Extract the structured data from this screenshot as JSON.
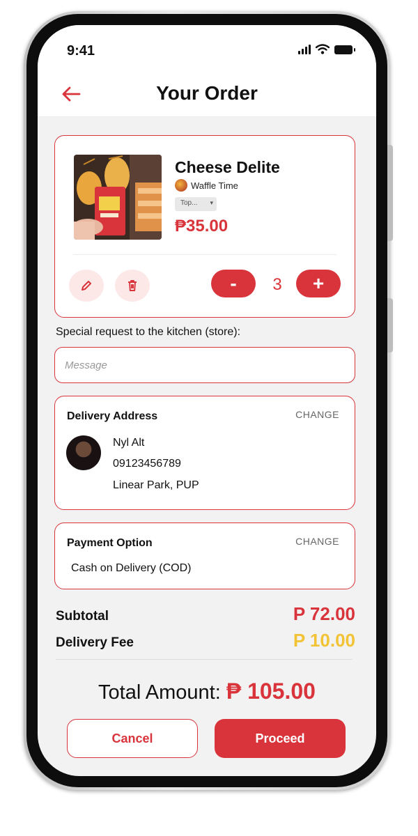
{
  "status_bar": {
    "time": "9:41"
  },
  "header": {
    "title": "Your Order"
  },
  "order_item": {
    "name": "Cheese Delite",
    "store": "Waffle Time",
    "topping_selected": "Top...",
    "price": "₱35.00",
    "quantity": "3",
    "minus_label": "-",
    "plus_label": "+"
  },
  "special_request": {
    "label": "Special request to the kitchen (store):",
    "placeholder": "Message"
  },
  "delivery": {
    "title": "Delivery Address",
    "change_label": "CHANGE",
    "name": "Nyl Alt",
    "phone": "09123456789",
    "address": "Linear Park, PUP"
  },
  "payment": {
    "title": "Payment Option",
    "change_label": "CHANGE",
    "method": "Cash on Delivery (COD)"
  },
  "summary": {
    "subtotal_label": "Subtotal",
    "subtotal_value": "P 72.00",
    "delivery_fee_label": "Delivery Fee",
    "delivery_fee_value": "P 10.00",
    "total_label": "Total Amount:",
    "total_value": "₱ 105.00"
  },
  "actions": {
    "cancel": "Cancel",
    "proceed": "Proceed"
  },
  "colors": {
    "accent": "#d9343b",
    "fee": "#f2c335",
    "background": "#f2f2f2"
  }
}
